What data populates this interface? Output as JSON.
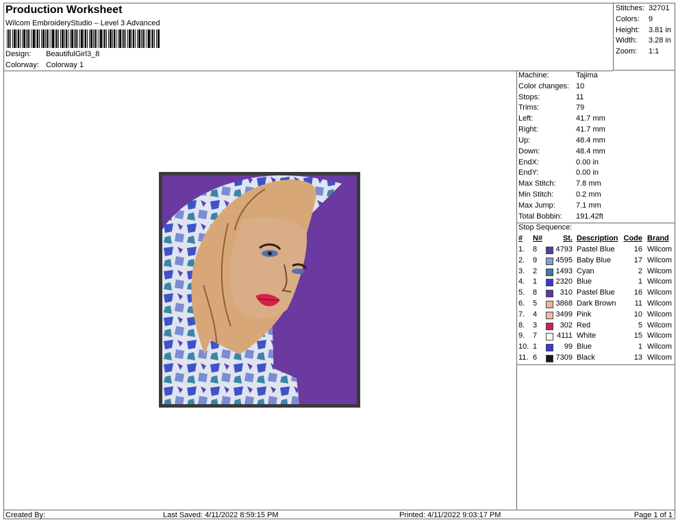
{
  "header": {
    "title": "Production Worksheet",
    "subtitle": "Wilcom EmbroideryStudio – Level 3 Advanced",
    "design_label": "Design:",
    "design_value": "BeautifulGirl3_8",
    "colorway_label": "Colorway:",
    "colorway_value": "Colorway 1"
  },
  "summary": [
    {
      "label": "Stitches:",
      "value": "32701"
    },
    {
      "label": "Colors:",
      "value": "9"
    },
    {
      "label": "Height:",
      "value": "3.81 in"
    },
    {
      "label": "Width:",
      "value": "3.28 in"
    },
    {
      "label": "Zoom:",
      "value": "1:1"
    }
  ],
  "machine": [
    {
      "label": "Machine:",
      "value": "Tajima"
    },
    {
      "label": "Color changes:",
      "value": "10"
    },
    {
      "label": "Stops:",
      "value": "11"
    },
    {
      "label": "Trims:",
      "value": "79"
    },
    {
      "label": "Left:",
      "value": "41.7 mm"
    },
    {
      "label": "Right:",
      "value": "41.7 mm"
    },
    {
      "label": "Up:",
      "value": "48.4 mm"
    },
    {
      "label": "Down:",
      "value": "48.4 mm"
    },
    {
      "label": "EndX:",
      "value": "0.00 in"
    },
    {
      "label": "EndY:",
      "value": "0.00 in"
    },
    {
      "label": "Max Stitch:",
      "value": "7.8 mm"
    },
    {
      "label": "Min Stitch:",
      "value": "0.2 mm"
    },
    {
      "label": "Max Jump:",
      "value": "7.1 mm"
    },
    {
      "label": "Total Bobbin:",
      "value": "191.42ft"
    }
  ],
  "stop_sequence": {
    "title": "Stop Sequence:",
    "columns": {
      "num": "#",
      "n": "N#",
      "st": "St.",
      "desc": "Description",
      "code": "Code",
      "brand": "Brand"
    },
    "rows": [
      {
        "num": "1.",
        "n": "8",
        "st": "4793",
        "desc": "Pastel Blue",
        "code": "16",
        "brand": "Wilcom",
        "color": "#5a3aa0"
      },
      {
        "num": "2.",
        "n": "9",
        "st": "4595",
        "desc": "Baby Blue",
        "code": "17",
        "brand": "Wilcom",
        "color": "#8a9ad0"
      },
      {
        "num": "3.",
        "n": "2",
        "st": "1493",
        "desc": "Cyan",
        "code": "2",
        "brand": "Wilcom",
        "color": "#3a7aa8"
      },
      {
        "num": "4.",
        "n": "1",
        "st": "2320",
        "desc": "Blue",
        "code": "1",
        "brand": "Wilcom",
        "color": "#3a3ad0"
      },
      {
        "num": "5.",
        "n": "8",
        "st": "310",
        "desc": "Pastel Blue",
        "code": "16",
        "brand": "Wilcom",
        "color": "#5a3aa0"
      },
      {
        "num": "6.",
        "n": "5",
        "st": "3868",
        "desc": "Dark Brown",
        "code": "11",
        "brand": "Wilcom",
        "color": "#f0b494"
      },
      {
        "num": "7.",
        "n": "4",
        "st": "3499",
        "desc": "Pink",
        "code": "10",
        "brand": "Wilcom",
        "color": "#f0b8a8"
      },
      {
        "num": "8.",
        "n": "3",
        "st": "302",
        "desc": "Red",
        "code": "5",
        "brand": "Wilcom",
        "color": "#d02050"
      },
      {
        "num": "9.",
        "n": "7",
        "st": "4111",
        "desc": "White",
        "code": "15",
        "brand": "Wilcom",
        "color": "#ffffff"
      },
      {
        "num": "10.",
        "n": "1",
        "st": "99",
        "desc": "Blue",
        "code": "1",
        "brand": "Wilcom",
        "color": "#3a3ad0"
      },
      {
        "num": "11.",
        "n": "6",
        "st": "7309",
        "desc": "Black",
        "code": "13",
        "brand": "Wilcom",
        "color": "#1a1a1a"
      }
    ]
  },
  "footer": {
    "created": "Created By:",
    "saved": "Last Saved: 4/11/2022 8:59:15 PM",
    "printed": "Printed: 4/11/2022 9:03:17 PM",
    "page": "Page 1 of 1"
  }
}
